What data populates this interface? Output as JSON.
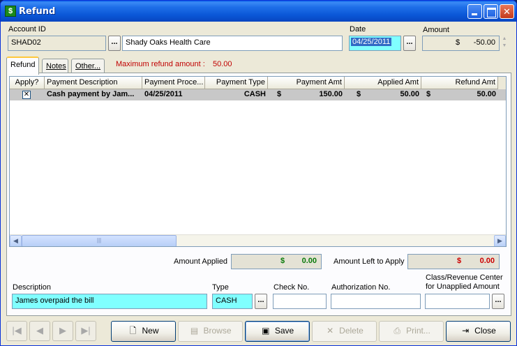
{
  "window": {
    "title": "Refund"
  },
  "header": {
    "account_id_label": "Account ID",
    "account_id": "SHAD02",
    "account_name": "Shady Oaks Health Care",
    "date_label": "Date",
    "date": "04/25/2011",
    "amount_label": "Amount",
    "amount_currency": "$",
    "amount": "-50.00",
    "lookup_glyph": "..."
  },
  "tabs": [
    {
      "label": "Refund"
    },
    {
      "label": "Notes"
    },
    {
      "label": "Other..."
    }
  ],
  "max_refund": {
    "label": "Maximum refund amount :",
    "value": "50.00"
  },
  "grid": {
    "columns": [
      "Apply?",
      "Payment Description",
      "Payment Proce...",
      "Payment Type",
      "Payment Amt",
      "Applied Amt",
      "Refund Amt"
    ],
    "rows": [
      {
        "apply": "✕",
        "description": "Cash payment by Jam...",
        "processed": "04/25/2011",
        "type": "CASH",
        "payment_cur": "$",
        "payment_amt": "150.00",
        "applied_cur": "$",
        "applied_amt": "50.00",
        "refund_cur": "$",
        "refund_amt": "50.00"
      }
    ]
  },
  "totals": {
    "applied_label": "Amount Applied",
    "applied_cur": "$",
    "applied_value": "0.00",
    "left_label": "Amount Left to Apply",
    "left_cur": "$",
    "left_value": "0.00",
    "applied_color": "#0a7a0a",
    "left_color": "#cc0000"
  },
  "details": {
    "description_label": "Description",
    "description": "James overpaid the bill",
    "type_label": "Type",
    "type": "CASH",
    "check_label": "Check No.",
    "check": "",
    "auth_label": "Authorization No.",
    "auth": "",
    "class_label_1": "Class/Revenue Center",
    "class_label_2": "for Unapplied Amount",
    "class": ""
  },
  "toolbar": {
    "new": "New",
    "browse": "Browse",
    "save": "Save",
    "delete": "Delete",
    "print": "Print...",
    "close": "Close"
  }
}
